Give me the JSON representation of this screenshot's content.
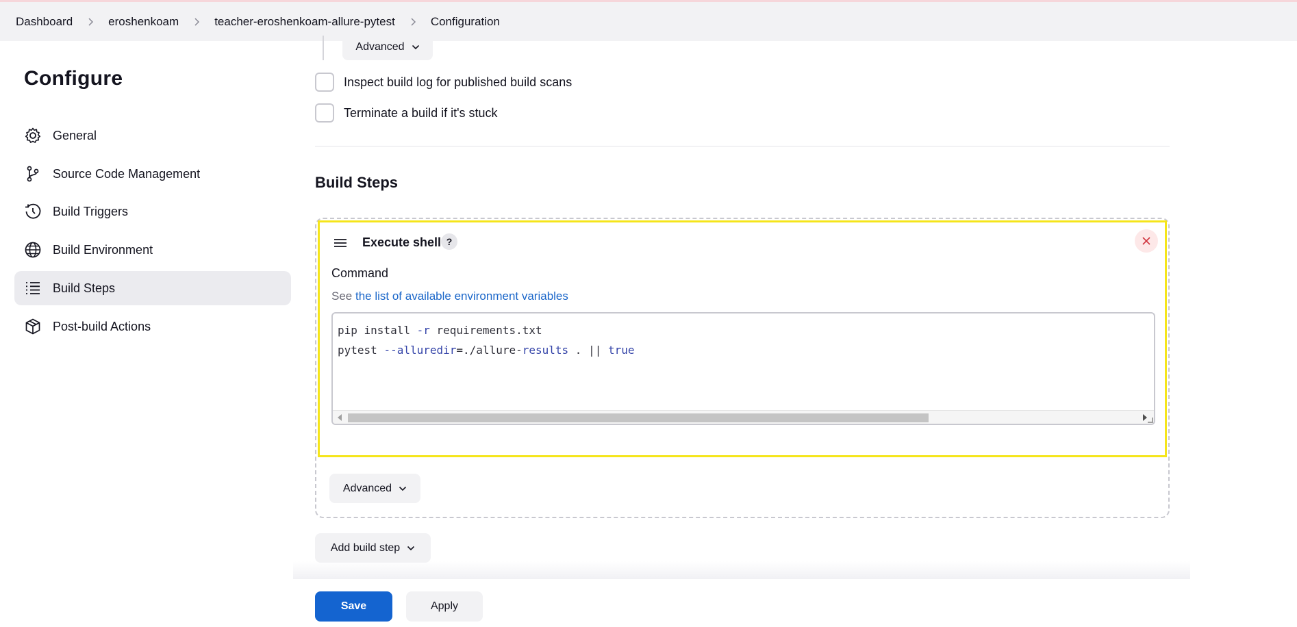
{
  "breadcrumb": [
    "Dashboard",
    "eroshenkoam",
    "teacher-eroshenkoam-allure-pytest",
    "Configuration"
  ],
  "sidebar": {
    "title": "Configure",
    "items": [
      {
        "label": "General",
        "icon": "gear-icon"
      },
      {
        "label": "Source Code Management",
        "icon": "branch-icon"
      },
      {
        "label": "Build Triggers",
        "icon": "clock-icon"
      },
      {
        "label": "Build Environment",
        "icon": "globe-icon"
      },
      {
        "label": "Build Steps",
        "icon": "list-icon",
        "active": true
      },
      {
        "label": "Post-build Actions",
        "icon": "package-icon"
      }
    ]
  },
  "main": {
    "advanced_top_label": "Advanced",
    "checkboxes": [
      {
        "label": "Inspect build log for published build scans",
        "checked": false
      },
      {
        "label": "Terminate a build if it's stuck",
        "checked": false
      }
    ],
    "section_title": "Build Steps",
    "step": {
      "title": "Execute shell",
      "help": "?",
      "command_label": "Command",
      "see_prefix": "See",
      "env_link": "the list of available environment variables",
      "code_line1": "pip install -r requirements.txt",
      "code_line2": "pytest --alluredir=./allure-results . || true"
    },
    "advanced_label": "Advanced",
    "add_step_label": "Add build step"
  },
  "footer": {
    "save_label": "Save",
    "apply_label": "Apply"
  },
  "colors": {
    "primary": "#1464d0",
    "highlight": "#f5e51b",
    "link": "#1a66c9"
  }
}
